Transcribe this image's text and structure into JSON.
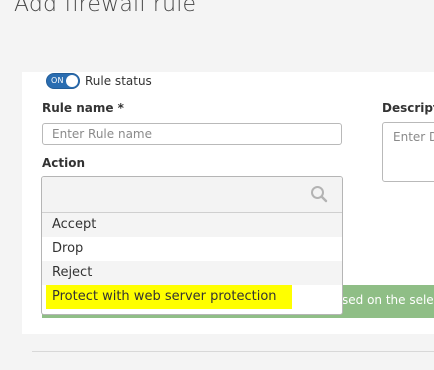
{
  "page": {
    "title": "Add firewall rule"
  },
  "rule_status": {
    "toggle_text": "ON",
    "label": "Rule status"
  },
  "form": {
    "rule_name_label": "Rule name *",
    "rule_name_placeholder": "Enter Rule name",
    "description_label": "Descriptio",
    "description_placeholder": "Enter D",
    "action_label": "Action"
  },
  "action_dropdown": {
    "search_value": "",
    "options": [
      {
        "label": "Accept"
      },
      {
        "label": "Drop"
      },
      {
        "label": "Reject"
      },
      {
        "label": "Protect with web server protection",
        "highlighted": true
      }
    ]
  },
  "banner": {
    "text": "sed on the selec",
    "color": "#8fbe86"
  },
  "colors": {
    "accent": "#2a6db1",
    "highlight": "#ffff00"
  }
}
